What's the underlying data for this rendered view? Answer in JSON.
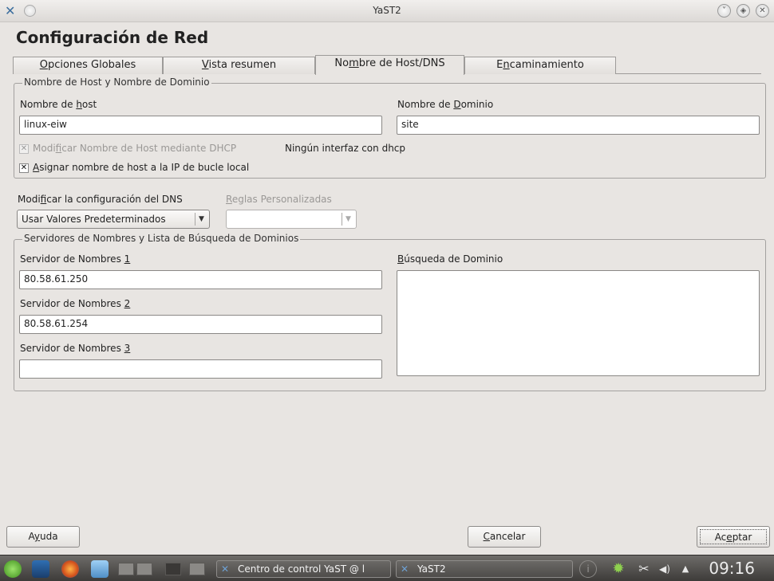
{
  "window": {
    "title": "YaST2"
  },
  "page_title": "Configuración de Red",
  "tabs": [
    {
      "label": "Opciones Globales",
      "mnemonic": "O",
      "rest": "pciones Globales"
    },
    {
      "label": "Vista resumen",
      "mnemonic": "V",
      "rest": "ista resumen"
    },
    {
      "label": "Nombre de Host/DNS",
      "pre": "No",
      "mnemonic": "m",
      "rest": "bre de Host/DNS"
    },
    {
      "label": "Encaminamiento",
      "pre": "E",
      "mnemonic": "n",
      "rest": "caminamiento"
    }
  ],
  "host_group": {
    "legend": "Nombre de Host y Nombre de Dominio",
    "hostname_label_pre": "Nombre de ",
    "hostname_label_mn": "h",
    "hostname_label_rest": "ost",
    "hostname_value": "linux-eiw",
    "domain_label_pre": "Nombre de ",
    "domain_label_mn": "D",
    "domain_label_rest": "ominio",
    "domain_value": "site",
    "dhcp_checkbox_pre": "Modi",
    "dhcp_checkbox_mn": "f",
    "dhcp_checkbox_rest": "icar Nombre de Host mediante DHCP",
    "dhcp_note": "Ningún interfaz con dhcp",
    "loopback_checkbox_mn": "A",
    "loopback_checkbox_rest": "signar nombre de host a la IP de bucle local"
  },
  "dns_config": {
    "label_pre": "Modi",
    "label_mn": "f",
    "label_rest": "icar la configuración del DNS",
    "selected": "Usar Valores Predeterminados",
    "rules_label_mn": "R",
    "rules_label_rest": "eglas Personalizadas",
    "rules_value": ""
  },
  "ns_group": {
    "legend": "Servidores de Nombres y Lista de Búsqueda de Dominios",
    "ns1_label_pre": "Servidor de Nombres ",
    "ns1_label_mn": "1",
    "ns1_value": "80.58.61.250",
    "ns2_label_pre": "Servidor de Nombres ",
    "ns2_label_mn": "2",
    "ns2_value": "80.58.61.254",
    "ns3_label_pre": "Servidor de Nombres ",
    "ns3_label_mn": "3",
    "ns3_value": "",
    "search_label_mn": "B",
    "search_label_rest": "úsqueda de Dominio"
  },
  "buttons": {
    "help_pre": "A",
    "help_mn": "y",
    "help_rest": "uda",
    "cancel_mn": "C",
    "cancel_rest": "ancelar",
    "accept_pre": "Ac",
    "accept_mn": "e",
    "accept_rest": "ptar"
  },
  "taskbar": {
    "task1": "Centro de control YaST @ l",
    "task2": "YaST2",
    "clock": "09:16"
  },
  "icons": {
    "app": "yast-icon",
    "menu": "window-menu-icon",
    "minimize": "minimize-icon",
    "maximize": "maximize-icon",
    "close": "close-icon"
  }
}
